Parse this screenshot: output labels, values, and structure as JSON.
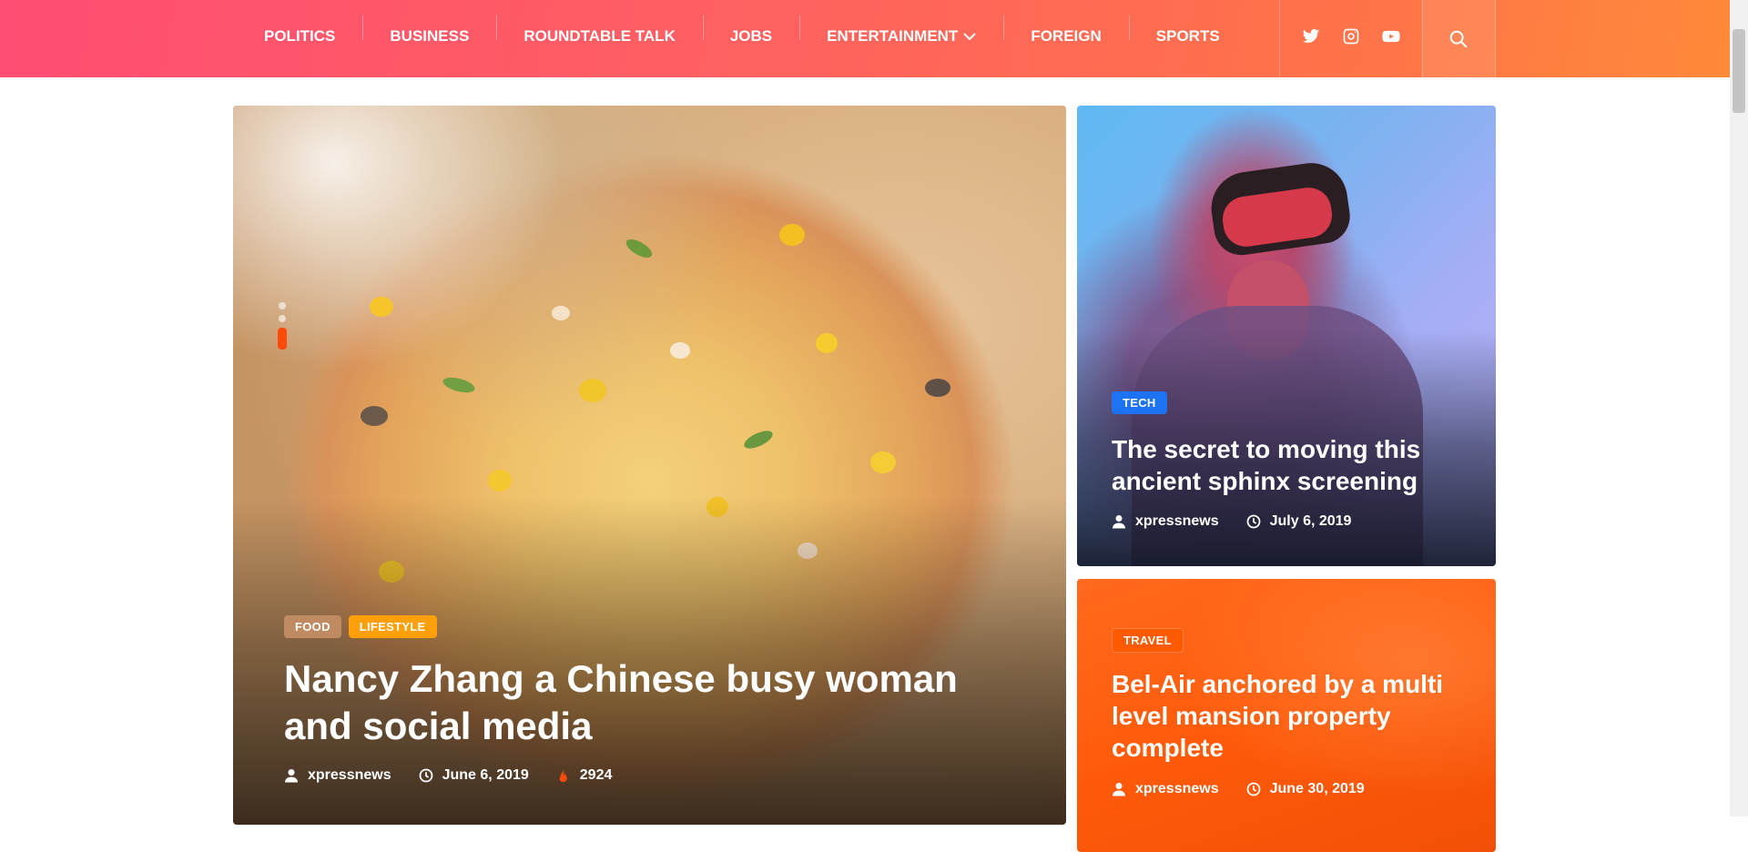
{
  "nav": {
    "items": [
      {
        "label": "POLITICS"
      },
      {
        "label": "BUSINESS"
      },
      {
        "label": "ROUNDTABLE TALK"
      },
      {
        "label": "JOBS"
      },
      {
        "label": "ENTERTAINMENT",
        "has_dropdown": true
      },
      {
        "label": "FOREIGN"
      },
      {
        "label": "SPORTS"
      }
    ],
    "social_icons": [
      "twitter-icon",
      "instagram-icon",
      "youtube-icon"
    ],
    "search_icon": "search-icon"
  },
  "featured": {
    "tags": [
      "FOOD",
      "LIFESTYLE"
    ],
    "title": "Nancy Zhang a Chinese busy woman and social media",
    "author": "xpressnews",
    "date": "June 6, 2019",
    "views": "2924",
    "slider": {
      "total": 3,
      "active": 3
    }
  },
  "side_posts": [
    {
      "tag": "TECH",
      "title": "The secret to moving this ancient sphinx screening",
      "author": "xpressnews",
      "date": "July 6, 2019"
    },
    {
      "tag": "TRAVEL",
      "title": "Bel-Air anchored by a multi level mansion property complete",
      "author": "xpressnews",
      "date": "June 30, 2019"
    }
  ],
  "colors": {
    "header_gradient_start": "#ff4d73",
    "header_gradient_end": "#ff8a3a",
    "food_tag": "#c08a62",
    "lifestyle_tag": "#ff9f0a",
    "tech_tag": "#1e72f4",
    "travel_card": "#ff5a0a",
    "fire_icon": "#ff4a0a"
  }
}
